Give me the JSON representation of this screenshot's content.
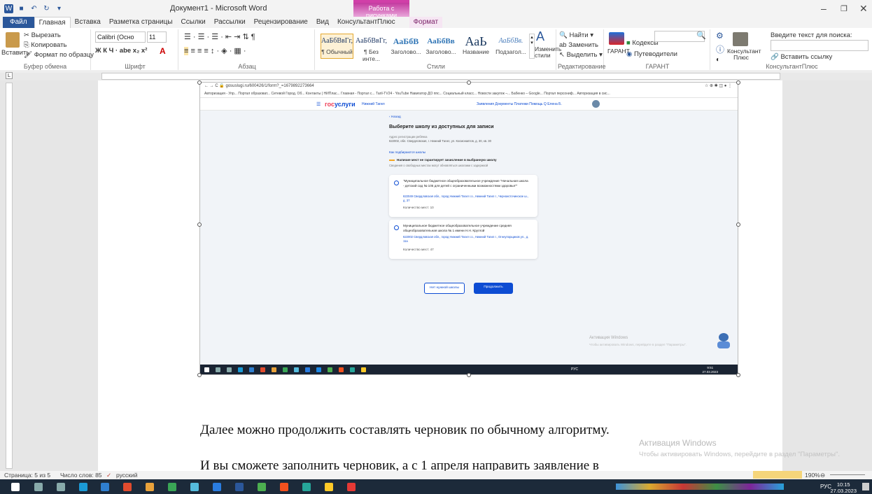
{
  "window": {
    "title": "Документ1 - Microsoft Word",
    "context_group": "Работа с рисунками"
  },
  "tabs": [
    "Файл",
    "Главная",
    "Вставка",
    "Разметка страницы",
    "Ссылки",
    "Рассылки",
    "Рецензирование",
    "Вид",
    "КонсультантПлюс",
    "Формат"
  ],
  "ribbon": {
    "clipboard": {
      "paste": "Вставить",
      "cut": "Вырезать",
      "copy": "Копировать",
      "format_painter": "Формат по образцу",
      "label": "Буфер обмена"
    },
    "font": {
      "name": "Calibri (Осно",
      "size": "11",
      "label": "Шрифт"
    },
    "paragraph": {
      "label": "Абзац"
    },
    "styles": {
      "items": [
        {
          "sample": "АаБбВвГг,",
          "name": "¶ Обычный"
        },
        {
          "sample": "АаБбВвГг,",
          "name": "¶ Без инте..."
        },
        {
          "sample": "АаБбВ",
          "name": "Заголово..."
        },
        {
          "sample": "АаБбВв",
          "name": "Заголово..."
        },
        {
          "sample": "АаЬ",
          "name": "Название"
        },
        {
          "sample": "АаБбВв.",
          "name": "Подзагол..."
        }
      ],
      "change": "Изменить стили",
      "label": "Стили"
    },
    "editing": {
      "find": "Найти",
      "replace": "Заменить",
      "select": "Выделить",
      "label": "Редактирование"
    },
    "garant": {
      "name": "ГАРАНТ",
      "codes": "Кодексы",
      "guide": "Путеводители",
      "label": "ГАРАНТ"
    },
    "consultant": {
      "name": "Консультант Плюс",
      "search_label": "Введите текст для поиска:",
      "insert_link": "Вставить ссылку",
      "label": "КонсультантПлюс"
    }
  },
  "embedded": {
    "browser_url": "gosuslugi.ru/600426/1/form?_=1679892273664",
    "bookmarks": "Авторизация - Упр...   Портал образоват...   Сетевой Город. Об...   Контакты | НИПлас...   Главная - Портал с...   Тагil-TV24 - YouTube   Навигатор ДО ппс...   Социальный класс...   Новости закупок –...   Бабенко – Google...   Портал персониф...   Авторизация в сис...",
    "logo_a": "гос",
    "logo_b": "услуги",
    "region": "Нижний Тагил",
    "nav": "Заявления   Документы   Платежи   Помощь   Q    Елена Б.",
    "back": "‹ Назад",
    "heading": "Выберите школу из доступных для записи",
    "addr_label": "Адрес регистрации ребёнка",
    "addr_value": "622002, обл. Свердловская, г. Нижний Тагил, ул. Космонавтов, д. 30, кв. 30",
    "how_link": "Как подбираются школы",
    "warn_title": "Наличие мест не гарантирует зачисление в выбранную школу",
    "warn_text": "Сведения о свободных местах могут обновляться школами с задержкой",
    "schools": [
      {
        "name": "\"Муниципальное бюджетное общеобразовательное учреждение \"Начальная школа - детский сад № 105 для детей с ограниченными возможностями здоровья\"\"",
        "address": "622049 Свердловская обл., город Нижний Тагил г.о., Нижний Тагил г., Черноисточинское ш., д. 37",
        "seats": "Количество мест: 10"
      },
      {
        "name": "Муниципальное бюджетное общеобразовательное учреждение средняя общеобразовательная школа № 1 имени Н.Н. Круглой",
        "address": "622002 Свердловская обл., город Нижний Тагил г.о., Нижний Тагил г., Огнеупорщиков ул., д. 11а",
        "seats": "Количество мест: 47"
      }
    ],
    "btn_none": "Нет нужной школы",
    "btn_next": "Продолжить",
    "activation_title": "Активация Windows",
    "activation_text": "Чтобы активировать Windows, перейдите в раздел \"Параметры\".",
    "clock_time": "9:51",
    "clock_date": "27.03.2023",
    "tray_lang": "РУС"
  },
  "document": {
    "para1": "Далее можно продолжить составлять черновик по обычному алгоритму.",
    "para2": "И вы сможете заполнить черновик, а с 1 апреля направить заявление в",
    "activation_title": "Активация Windows",
    "activation_text": "Чтобы активировать Windows, перейдите в раздел \"Параметры\"."
  },
  "status": {
    "page": "Страница: 5 из 5",
    "words": "Число слов: 85",
    "lang": "русский",
    "zoom": "190%"
  },
  "taskbar": {
    "lang": "РУС",
    "time": "10:15",
    "date": "27.03.2023"
  }
}
